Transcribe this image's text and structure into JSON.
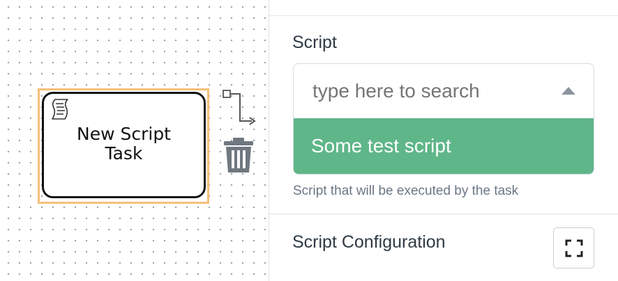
{
  "canvas": {
    "task": {
      "label": "New Script\nTask",
      "icon": "script-scroll-icon"
    },
    "context_pad": {
      "connect_icon": "connect-arrow-icon",
      "delete_icon": "trash-icon"
    }
  },
  "panel": {
    "script": {
      "label": "Script",
      "search_placeholder": "type here to search",
      "options": [
        {
          "label": "Some test script",
          "highlighted": true
        }
      ],
      "help": "Script that will be executed by the task"
    },
    "script_configuration": {
      "label": "Script Configuration",
      "expand_icon": "fullscreen-icon"
    }
  },
  "colors": {
    "selection": "#f6bf7a",
    "option_highlight": "#5fb689",
    "text": "#2f3a45"
  }
}
